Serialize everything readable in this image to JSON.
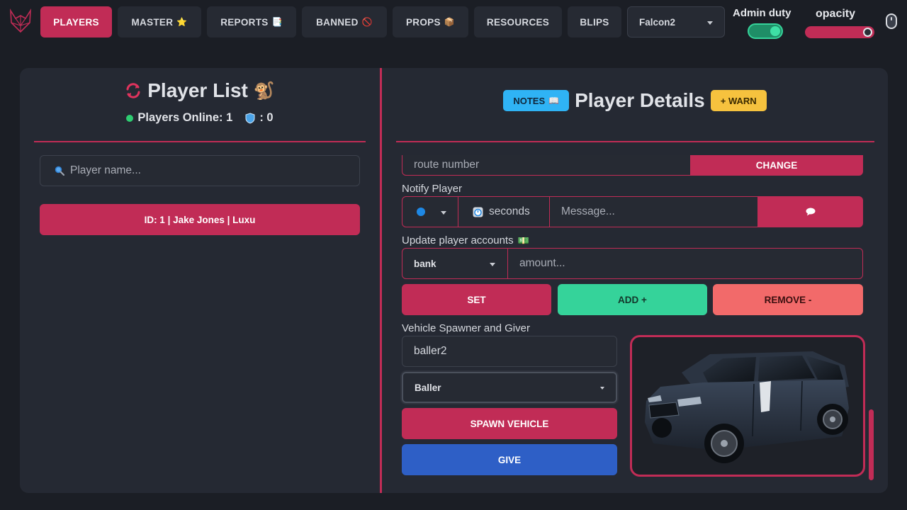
{
  "nav": {
    "items": [
      {
        "label": "PLAYERS",
        "emoji": ""
      },
      {
        "label": "MASTER",
        "emoji": "⭐"
      },
      {
        "label": "REPORTS",
        "emoji": "📑"
      },
      {
        "label": "BANNED",
        "emoji": "🚫"
      },
      {
        "label": "PROPS",
        "emoji": "📦"
      },
      {
        "label": "RESOURCES",
        "emoji": ""
      },
      {
        "label": "BLIPS",
        "emoji": ""
      }
    ],
    "player_select": "Falcon2",
    "admin_duty_label": "Admin duty",
    "admin_duty_on": true,
    "opacity_label": "opacity",
    "opacity_value": 1.0
  },
  "player_list": {
    "title": "Player List",
    "title_emoji": "🐒",
    "online_text": "Players Online: 1",
    "admins_text": ": 0",
    "search_placeholder": "Player name...",
    "players": [
      {
        "label": "ID: 1 | Jake Jones | Luxu"
      }
    ]
  },
  "player_details": {
    "notes_label": "NOTES",
    "notes_emoji": "📖",
    "title": "Player Details",
    "warn_label": "+ WARN",
    "route_placeholder": "route number",
    "change_label": "CHANGE",
    "notify_label": "Notify Player",
    "seconds_label": "seconds",
    "message_placeholder": "Message...",
    "accounts_label": "Update player accounts",
    "accounts_emoji": "💵",
    "account_select": "bank",
    "amount_placeholder": "amount...",
    "set_label": "SET",
    "add_label": "ADD +",
    "remove_label": "REMOVE -",
    "vehicle_label": "Vehicle Spawner and Giver",
    "vehicle_input": "baller2",
    "vehicle_select": "Baller",
    "spawn_label": "SPAWN VEHICLE",
    "give_label": "GIVE"
  },
  "colors": {
    "accent": "#c12c56",
    "background": "#1b1e25",
    "panel": "#252933",
    "success": "#35d39a",
    "danger": "#f26a6a",
    "info": "#2fb3f5",
    "warning": "#f6c23e",
    "primary": "#2e5fc6"
  }
}
